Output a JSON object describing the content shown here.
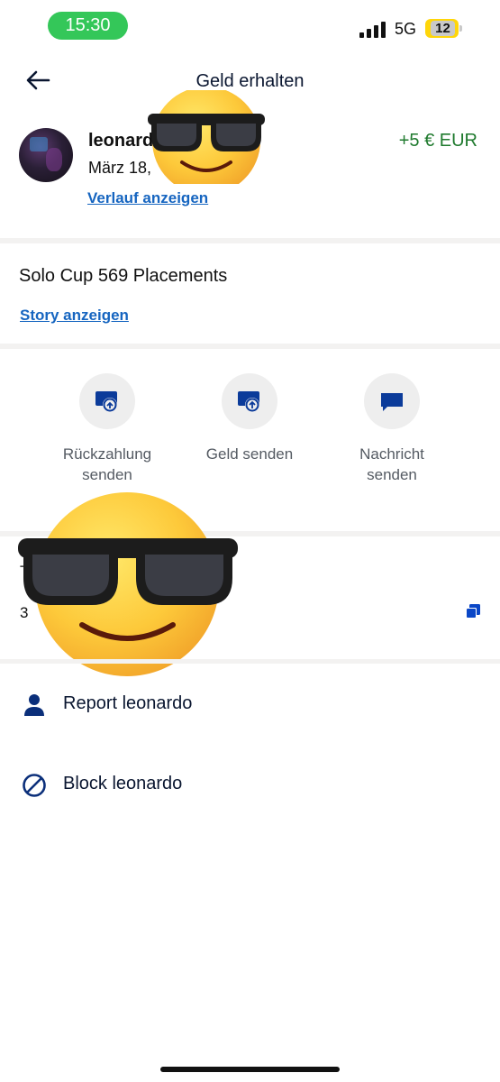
{
  "status_bar": {
    "time": "15:30",
    "network": "5G",
    "battery": "12"
  },
  "header": {
    "title": "Geld erhalten"
  },
  "transaction": {
    "sender": "leonardo",
    "date": "März 18,",
    "amount": "+5 € EUR",
    "history_link": "Verlauf anzeigen"
  },
  "note": {
    "text": "Solo Cup 569 Placements",
    "story_link": "Story anzeigen"
  },
  "actions": {
    "refund": "Rückzahlung senden",
    "send_money": "Geld senden",
    "message": "Nachricht senden"
  },
  "transaction_info": {
    "label": "T",
    "id": "3"
  },
  "options": {
    "report": "Report leonardo",
    "block": "Block leonardo"
  },
  "colors": {
    "link": "#1665c0",
    "positive": "#1f7a2e",
    "icon": "#0b3b9a",
    "time_pill": "#34c759",
    "battery": "#ffd60a"
  },
  "icons": [
    "back-arrow-icon",
    "refund-icon",
    "send-money-icon",
    "message-icon",
    "copy-icon",
    "person-icon",
    "block-icon",
    "sunglasses-emoji-icon"
  ]
}
